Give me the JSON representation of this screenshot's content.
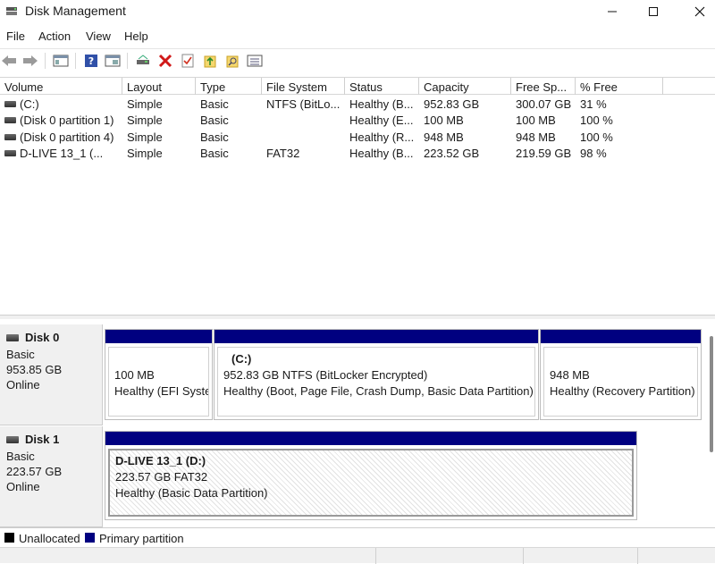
{
  "window": {
    "title": "Disk Management"
  },
  "menu": [
    "File",
    "Action",
    "View",
    "Help"
  ],
  "toolbar": {
    "icons": [
      "back-icon",
      "forward-icon",
      "console-tree-icon",
      "help-icon",
      "properties-icon",
      "connect-disk-icon",
      "delete-icon",
      "check-icon",
      "export-icon",
      "find-icon",
      "list-view-icon"
    ]
  },
  "list": {
    "columns": [
      "Volume",
      "Layout",
      "Type",
      "File System",
      "Status",
      "Capacity",
      "Free Sp...",
      "% Free"
    ],
    "rows": [
      {
        "volume": "(C:)",
        "layout": "Simple",
        "type": "Basic",
        "fs": "NTFS (BitLo...",
        "status": "Healthy (B...",
        "capacity": "952.83 GB",
        "free": "300.07 GB",
        "pct": "31 %"
      },
      {
        "volume": "(Disk 0 partition 1)",
        "layout": "Simple",
        "type": "Basic",
        "fs": "",
        "status": "Healthy (E...",
        "capacity": "100 MB",
        "free": "100 MB",
        "pct": "100 %"
      },
      {
        "volume": "(Disk 0 partition 4)",
        "layout": "Simple",
        "type": "Basic",
        "fs": "",
        "status": "Healthy (R...",
        "capacity": "948 MB",
        "free": "948 MB",
        "pct": "100 %"
      },
      {
        "volume": "D-LIVE 13_1 (...",
        "layout": "Simple",
        "type": "Basic",
        "fs": "FAT32",
        "status": "Healthy (B...",
        "capacity": "223.52 GB",
        "free": "219.59 GB",
        "pct": "98 %"
      }
    ]
  },
  "disks": [
    {
      "name": "Disk 0",
      "kind": "Basic",
      "size": "953.85 GB",
      "state": "Online",
      "partitions": [
        {
          "title": "",
          "line1": "100 MB",
          "line2": "Healthy (EFI System Partition)"
        },
        {
          "title": "(C:)",
          "line1": "952.83 GB NTFS (BitLocker Encrypted)",
          "line2": "Healthy (Boot, Page File, Crash Dump, Basic Data Partition)"
        },
        {
          "title": "",
          "line1": "948 MB",
          "line2": "Healthy (Recovery Partition)"
        }
      ]
    },
    {
      "name": "Disk 1",
      "kind": "Basic",
      "size": "223.57 GB",
      "state": "Online",
      "partitions": [
        {
          "title": "D-LIVE 13_1  (D:)",
          "line1": "223.57 GB FAT32",
          "line2": "Healthy (Basic Data Partition)"
        }
      ]
    }
  ],
  "legend": [
    {
      "label": "Unallocated",
      "color": "#000000"
    },
    {
      "label": "Primary partition",
      "color": "#000080"
    }
  ],
  "colors": {
    "primary": "#000080",
    "unallocated": "#000000"
  }
}
